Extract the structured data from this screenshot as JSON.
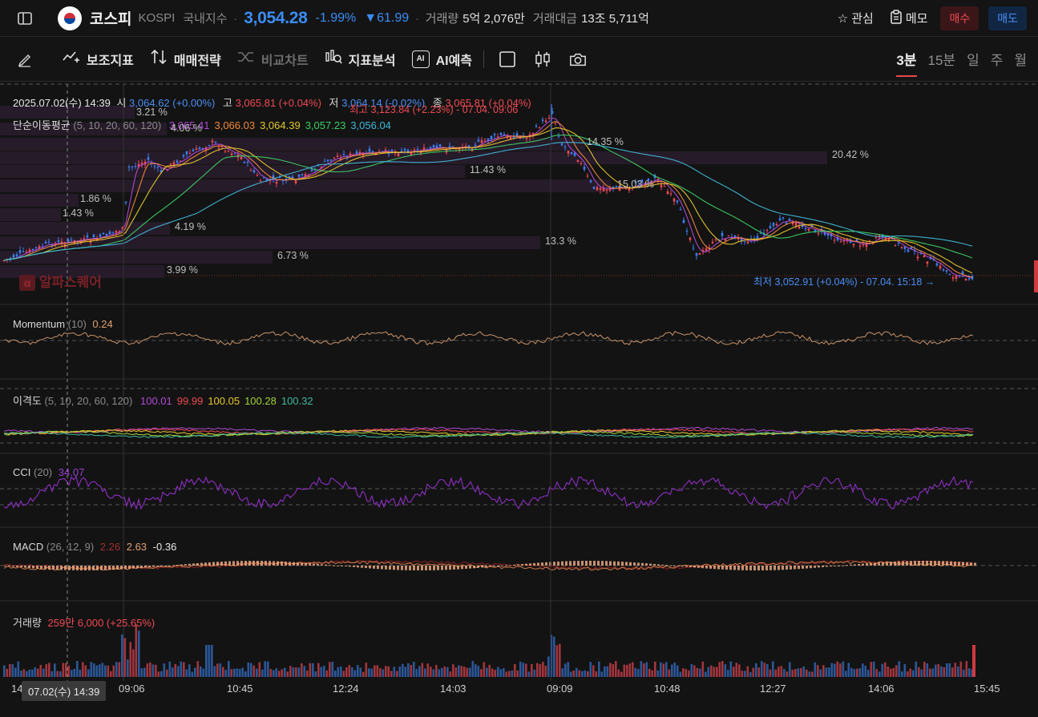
{
  "header": {
    "name": "코스피",
    "code": "KOSPI",
    "category": "국내지수",
    "price": "3,054.28",
    "change_pct": "-1.99%",
    "change_abs": "▼61.99",
    "volume_label": "거래량",
    "volume_value": "5억 2,076만",
    "amount_label": "거래대금",
    "amount_value": "13조 5,711억",
    "watch_label": "관심",
    "memo_label": "메모",
    "buy_label": "매수",
    "sell_label": "매도"
  },
  "toolbar": {
    "indicators": "보조지표",
    "strategy": "매매전략",
    "compare": "비교차트",
    "analysis": "지표분석",
    "ai_label": "AI",
    "ai_predict": "AI예측",
    "timeframes": [
      "3분",
      "15분",
      "일",
      "주",
      "월"
    ],
    "active_timeframe": "3분"
  },
  "ohlc": {
    "date": "2025.07.02(수) 14:39",
    "open_label": "시",
    "open": "3,064.62 (+0.00%)",
    "high_label": "고",
    "high": "3,065.81 (+0.04%)",
    "low_label": "저",
    "low": "3,064.14 (-0.02%)",
    "close_label": "종",
    "close": "3,065.81 (+0.04%)"
  },
  "ma": {
    "name": "단순이동평균",
    "params": "(5, 10, 20, 60, 120)",
    "values": [
      "3,065.41",
      "3,066.03",
      "3,064.39",
      "3,057.23",
      "3,056.04"
    ],
    "colors": [
      "#b04bd6",
      "#f08a3a",
      "#e6c82e",
      "#3ccf64",
      "#3fb8d8"
    ]
  },
  "annotations": {
    "high": "최고 3,123.84 (+2.23%) - 07.04. 09:06",
    "low": "최저 3,052.91 (+0.04%) - 07.04. 15:18",
    "watermark": "알파스퀘어"
  },
  "profile_labels": [
    "3.21 %",
    "4.06 %",
    "14.35 %",
    "20.42 %",
    "11.43 %",
    "15.03 %",
    "1.86 %",
    "1.43 %",
    "4.19 %",
    "13.3 %",
    "6.73 %",
    "3.99 %"
  ],
  "panes": {
    "momentum": {
      "name": "Momentum",
      "params": "(10)",
      "value": "0.24"
    },
    "disparity": {
      "name": "이격도",
      "params": "(5, 10, 20, 60, 120)",
      "values": [
        "100.01",
        "99.99",
        "100.05",
        "100.28",
        "100.32"
      ],
      "colors": [
        "#b04bd6",
        "#ef4a54",
        "#e6c82e",
        "#a5d43a",
        "#3fb89a"
      ]
    },
    "cci": {
      "name": "CCI",
      "params": "(20)",
      "value": "34.07"
    },
    "macd": {
      "name": "MACD",
      "params": "(26, 12, 9)",
      "values": [
        "2.26",
        "2.63",
        "-0.36"
      ]
    },
    "volume": {
      "name": "거래량",
      "value": "259만 6,000 (+25.65%)"
    }
  },
  "x_axis": {
    "labels": [
      "14",
      "09:06",
      "10:45",
      "12:24",
      "14:03",
      "09:09",
      "10:48",
      "12:27",
      "14:06",
      "15:45"
    ],
    "crosshair": "07.02(수) 14:39"
  },
  "colors": {
    "up": "#ef4a54",
    "down": "#3b7ef0",
    "bg": "#131313"
  }
}
